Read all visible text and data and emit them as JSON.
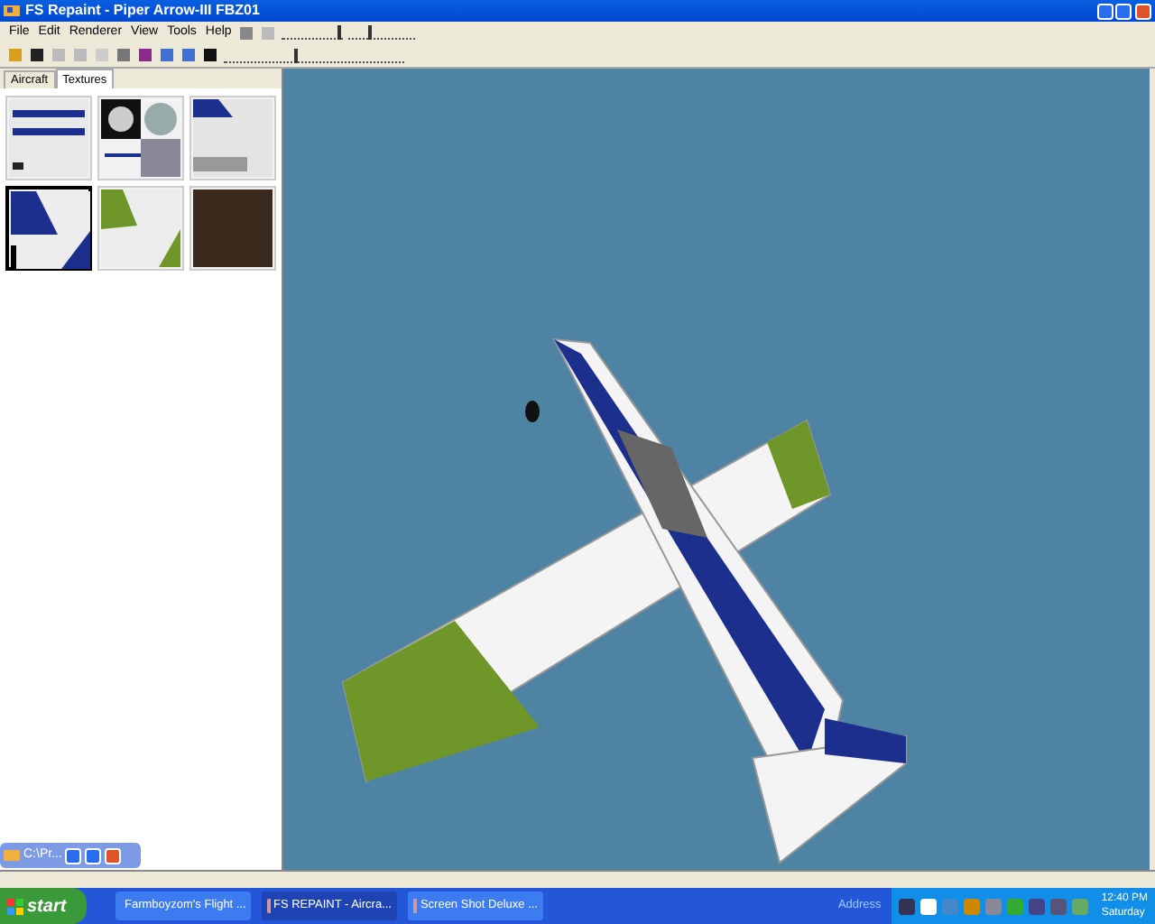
{
  "window": {
    "title": "FS Repaint - Piper Arrow-III FBZ01"
  },
  "menu": [
    {
      "label": "File"
    },
    {
      "label": "Edit"
    },
    {
      "label": "Renderer"
    },
    {
      "label": "View"
    },
    {
      "label": "Tools"
    },
    {
      "label": "Help"
    }
  ],
  "sliders": [
    {
      "level": 0.95
    },
    {
      "level": 0.3
    },
    {
      "level": 0.4
    }
  ],
  "tabs": [
    {
      "label": "Aircraft",
      "selected": false
    },
    {
      "label": "Textures",
      "selected": true
    }
  ],
  "textures": [
    {
      "kind": "stripes",
      "selected": false
    },
    {
      "kind": "discs",
      "selected": false
    },
    {
      "kind": "tailmap",
      "selected": false
    },
    {
      "kind": "bluefin",
      "selected": true
    },
    {
      "kind": "greenfin",
      "selected": false
    },
    {
      "kind": "photo",
      "selected": false
    }
  ],
  "minimized_window": {
    "title": "C:\\Pr..."
  },
  "taskbar": {
    "start": "start",
    "tasks": [
      {
        "label": "Farmboyzom's Flight ...",
        "selected": false
      },
      {
        "label": "FS REPAINT - Aircra...",
        "selected": true
      },
      {
        "label": "Screen Shot Deluxe ...",
        "selected": false
      }
    ],
    "address": "Address",
    "clock": "12:40 PM",
    "day": "Saturday"
  }
}
